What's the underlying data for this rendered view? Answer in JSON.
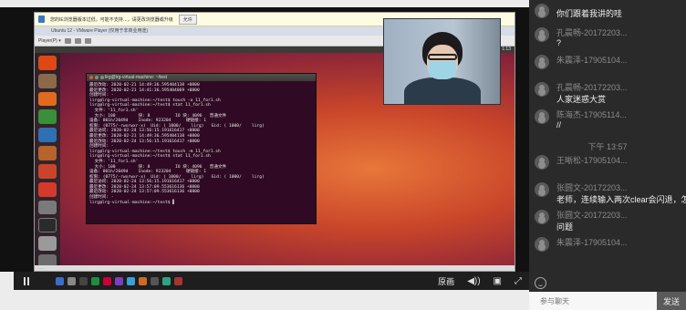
{
  "ie_bar": {
    "text": "您的IE浏览器版本过低，可能不支持…，请更改浏览器或升级",
    "button": "允许"
  },
  "vm": {
    "title": "Ubuntu 12 - VMware Player (仅用于非商业用途)",
    "player_menu": "Player(P) ▾",
    "status": "……"
  },
  "ubuntu": {
    "panel_time": "下午 1:13"
  },
  "terminal": {
    "title": "lirg@lrg-virtual-machine: ~/test",
    "lines": [
      "最近改动: 2020-02-21 14:49:36.595404138 +0800",
      "最近更改: 2020-02-21 14:41:36.595404069 +0800",
      "创建时间: -",
      "lirg@lrg-virtual-machine:~/test$ touch -a 11_for1.sh",
      "lirg@lrg-virtual-machine:~/test$ stat 11_for1.sh",
      "  文件: '11_for1.sh'",
      "  大小: 100         块: 8          IO 块: 4096   普通文件",
      "设备: 801h/2049d    Inode: 923204      硬链接: 1",
      "权限: (0775/-rwxrwxr-x)  Uid: ( 1000/    lirg)   Gid: ( 1000/    lirg)",
      "最近访问: 2020-02-24 13:56:15.191616417 +0800",
      "最近更改: 2020-02-21 14:49:36.595404138 +0800",
      "最近改动: 2020-02-24 13:56:15.191616417 +0800",
      "创建时间: -",
      "lirg@lrg-virtual-machine:~/test$ touch -m 11_for1.sh",
      "lirg@lrg-virtual-machine:~/test$ stat 11_for1.sh",
      "  文件: '11_for1.sh'",
      "  大小: 100         块: 8          IO 块: 4096   普通文件",
      "设备: 801h/2049d    Inode: 923204      硬链接: 1",
      "权限: (0775/-rwxrwxr-x)  Uid: ( 1000/    lirg)   Gid: ( 1000/    lirg)",
      "最近访问: 2020-02-24 13:56:15.191616417 +0800",
      "最近更改: 2020-02-24 13:57:09.553616136 +0800",
      "最近改动: 2020-02-24 13:57:09.553616136 +0800",
      "创建时间: -",
      "lirg@lrg-virtual-machine:~/test$ ▌"
    ]
  },
  "controls": {
    "quality": "原画"
  },
  "chat": {
    "messages": [
      {
        "name": "",
        "text": "你们跟着我讲的哇"
      },
      {
        "name": "孔晨畅-20172203...",
        "text": "?"
      },
      {
        "name": "朱震泽-17905104...",
        "text": ""
      },
      {
        "name": "孔晨畅-20172203...",
        "text": "人家迷惑大赏"
      },
      {
        "name": "陈海杰-17905114...",
        "text": "//"
      },
      {
        "name": "王晰松-17905104...",
        "text": ""
      },
      {
        "name": "张圆文-20172203...",
        "text": "老师，连续输入两次clear会闪退，怎么办"
      },
      {
        "name": "张圆文-20172203...",
        "text": "问题"
      },
      {
        "name": "朱震泽-17905104...",
        "text": ""
      }
    ],
    "time_divider": "下午 13:57",
    "input_placeholder": "参与聊天",
    "send_label": "发送"
  },
  "colors": {
    "terminal_bg": "#300a24",
    "chat_bg": "#2a2a2a",
    "ubuntu_orange": "#dd4814"
  }
}
